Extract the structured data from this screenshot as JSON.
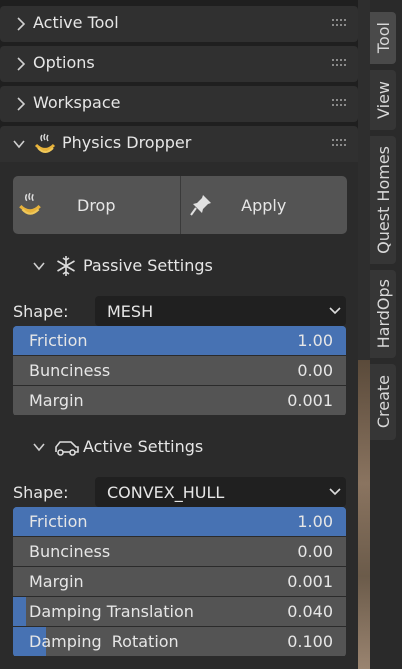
{
  "panels": {
    "active_tool": "Active Tool",
    "options": "Options",
    "workspace": "Workspace",
    "physics_dropper": "Physics Dropper"
  },
  "buttons": {
    "drop": "Drop",
    "apply": "Apply"
  },
  "passive": {
    "title": "Passive Settings",
    "shape_label": "Shape:",
    "shape_value": "MESH",
    "fields": [
      {
        "name": "Friction",
        "value": "1.00",
        "fill": 1.0
      },
      {
        "name": "Bunciness",
        "value": "0.00",
        "fill": 0.0
      },
      {
        "name": "Margin",
        "value": "0.001",
        "fill": 0.0
      }
    ]
  },
  "active": {
    "title": "Active Settings",
    "shape_label": "Shape:",
    "shape_value": "CONVEX_HULL",
    "fields": [
      {
        "name": "Friction",
        "value": "1.00",
        "fill": 1.0
      },
      {
        "name": "Bunciness",
        "value": "0.00",
        "fill": 0.0
      },
      {
        "name": "Margin",
        "value": "0.001",
        "fill": 0.0
      },
      {
        "name": "Damping Translation",
        "value": "0.040",
        "fill": 0.04
      },
      {
        "name": "Damping  Rotation",
        "value": "0.100",
        "fill": 0.1
      }
    ]
  },
  "sidebar_tabs": [
    "Tool",
    "View",
    "Quest Homes",
    "HardOps",
    "Create"
  ],
  "colors": {
    "accent": "#4772b3",
    "field": "#545454",
    "panel": "#303030"
  }
}
